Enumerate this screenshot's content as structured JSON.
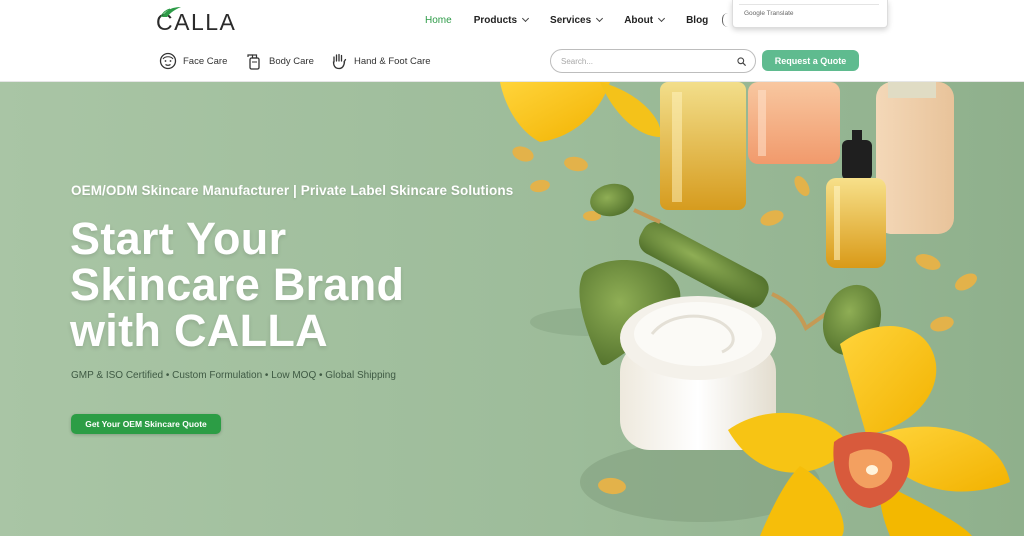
{
  "brand": {
    "logo_text": "CALLA"
  },
  "nav": {
    "items": [
      {
        "label": "Home",
        "active": true,
        "dropdown": false
      },
      {
        "label": "Products",
        "active": false,
        "dropdown": true
      },
      {
        "label": "Services",
        "active": false,
        "dropdown": true
      },
      {
        "label": "About",
        "active": false,
        "dropdown": true
      },
      {
        "label": "Blog",
        "active": false,
        "dropdown": false
      }
    ]
  },
  "translate_widget": {
    "label": "Google Translate"
  },
  "categories": [
    {
      "label": "Face Care",
      "icon": "face-icon"
    },
    {
      "label": "Body Care",
      "icon": "lotion-bottle-icon"
    },
    {
      "label": "Hand & Foot Care",
      "icon": "hand-icon"
    }
  ],
  "search": {
    "placeholder": "Search..."
  },
  "header_cta": {
    "label": "Request a Quote"
  },
  "hero": {
    "kicker": "OEM/ODM Skincare Manufacturer | Private Label Skincare Solutions",
    "title_lines": [
      "Start Your",
      "Skincare Brand",
      "with CALLA"
    ],
    "features": "GMP & ISO Certified • Custom Formulation • Low MOQ • Global Shipping",
    "cta_label": "Get Your OEM Skincare Quote"
  },
  "colors": {
    "accent_green": "#2d9b47",
    "quote_button": "#5fbb8f",
    "hero_bg": "#9fbd9f"
  }
}
